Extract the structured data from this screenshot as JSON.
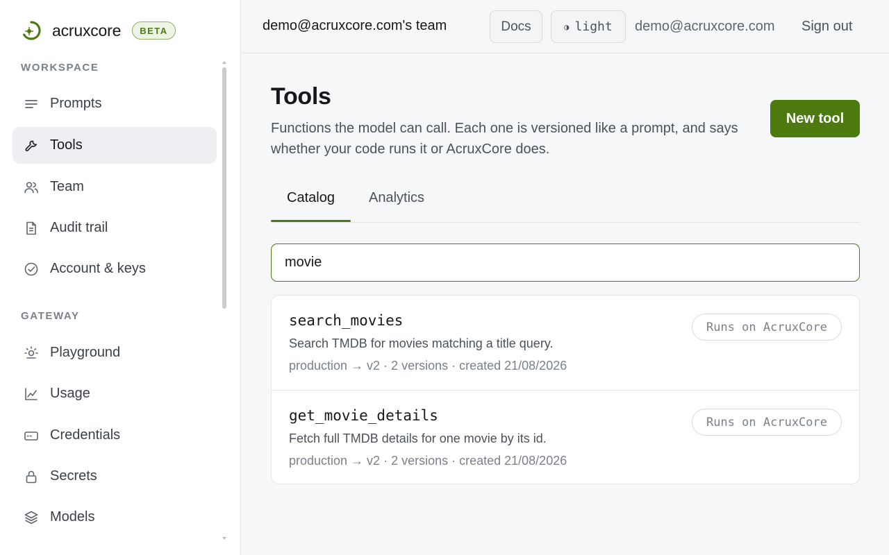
{
  "brand": {
    "name": "acruxcore",
    "badge": "BETA",
    "accent": "#4c7a0f"
  },
  "sidebar": {
    "sections": [
      {
        "label": "WORKSPACE",
        "items": [
          {
            "label": "Prompts",
            "icon": "list-lines-icon"
          },
          {
            "label": "Tools",
            "icon": "wrench-icon",
            "active": true
          },
          {
            "label": "Team",
            "icon": "users-icon"
          },
          {
            "label": "Audit trail",
            "icon": "document-icon"
          },
          {
            "label": "Account & keys",
            "icon": "check-circle-icon"
          }
        ]
      },
      {
        "label": "GATEWAY",
        "items": [
          {
            "label": "Playground",
            "icon": "sun-icon"
          },
          {
            "label": "Usage",
            "icon": "line-chart-icon"
          },
          {
            "label": "Credentials",
            "icon": "card-icon"
          },
          {
            "label": "Secrets",
            "icon": "lock-icon"
          },
          {
            "label": "Models",
            "icon": "layers-icon"
          }
        ]
      }
    ]
  },
  "header": {
    "team": "demo@acruxcore.com's team",
    "docs_label": "Docs",
    "theme_label": "light",
    "theme_icon": "half-circle-icon",
    "user_email": "demo@acruxcore.com",
    "signout_label": "Sign out"
  },
  "main": {
    "title": "Tools",
    "description": "Functions the model can call. Each one is versioned like a prompt, and says whether your code runs it or AcruxCore does.",
    "new_button_label": "New tool",
    "tabs": [
      {
        "label": "Catalog",
        "active": true
      },
      {
        "label": "Analytics",
        "active": false
      }
    ],
    "search": {
      "value": "movie",
      "placeholder": ""
    },
    "tools": [
      {
        "name": "search_movies",
        "description": "Search TMDB for movies matching a title query.",
        "meta": "production → v2 · 2 versions · created 21/08/2026",
        "runtime": "Runs on AcruxCore"
      },
      {
        "name": "get_movie_details",
        "description": "Fetch full TMDB details for one movie by its id.",
        "meta": "production → v2 · 2 versions · created 21/08/2026",
        "runtime": "Runs on AcruxCore"
      }
    ]
  }
}
